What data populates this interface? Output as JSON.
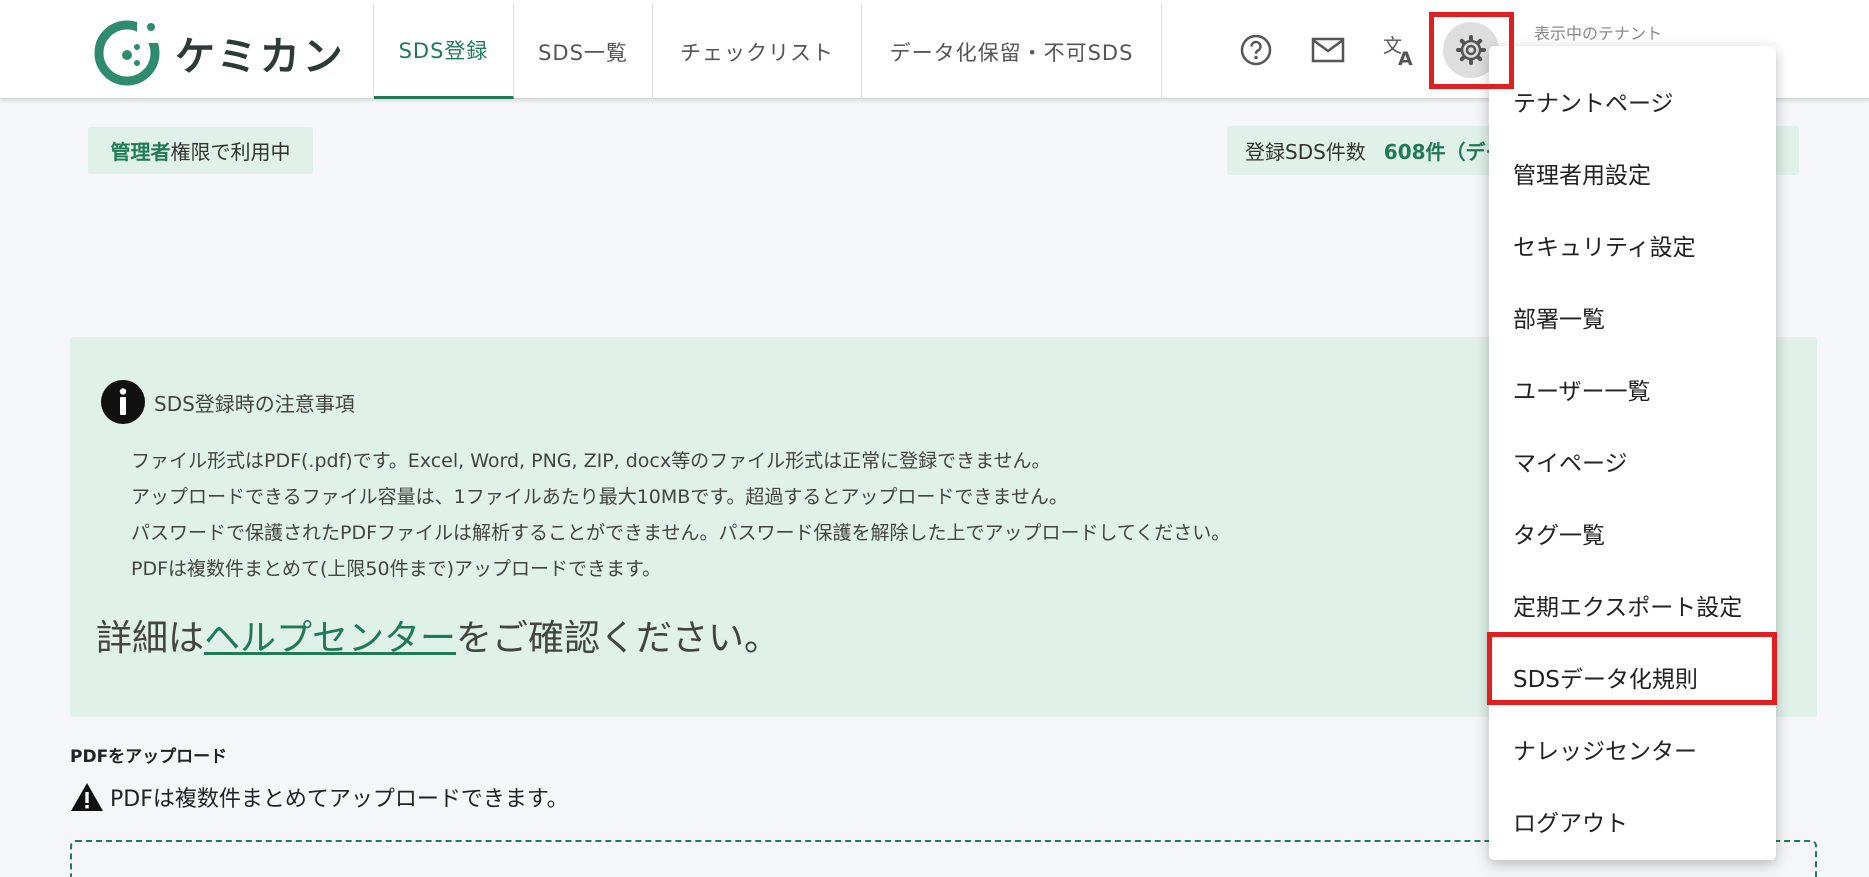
{
  "header": {
    "logo_text": "ケミカン",
    "nav_tabs": [
      {
        "label": "SDS登録",
        "active": true
      },
      {
        "label": "SDS一覧",
        "active": false
      },
      {
        "label": "チェックリスト",
        "active": false
      },
      {
        "label": "データ化保留・不可SDS",
        "active": false
      }
    ],
    "icons": [
      "help-circle-icon",
      "mail-icon",
      "translate-icon",
      "gear-icon"
    ],
    "tenant_label": "表示中のテナント"
  },
  "status": {
    "role_name": "管理者",
    "role_suffix": "権限で利用中",
    "count_label": "登録SDS件数",
    "count_value": "608件（デー"
  },
  "notice": {
    "title": "SDS登録時の注意事項",
    "lines": [
      "ファイル形式はPDF(.pdf)です。Excel, Word, PNG, ZIP, docx等のファイル形式は正常に登録できません。",
      "アップロードできるファイル容量は、1ファイルあたり最大10MBです。超過するとアップロードできません。",
      "パスワードで保護されたPDFファイルは解析することができません。パスワード保護を解除した上でアップロードしてください。",
      "PDFは複数件まとめて(上限50件まで)アップロードできます。"
    ],
    "help_prefix": "詳細は",
    "help_link": "ヘルプセンター",
    "help_suffix": "をご確認ください。"
  },
  "upload": {
    "label": "PDFをアップロード",
    "warning": "PDFは複数件まとめてアップロードできます。"
  },
  "menu": {
    "items": [
      {
        "label": "テナントページ"
      },
      {
        "label": "管理者用設定"
      },
      {
        "label": "セキュリティ設定"
      },
      {
        "label": "部署一覧"
      },
      {
        "label": "ユーザー一覧"
      },
      {
        "label": "マイページ"
      },
      {
        "label": "タグ一覧"
      },
      {
        "label": "定期エクスポート設定"
      },
      {
        "label": "SDSデータ化規則"
      },
      {
        "label": "ナレッジセンター"
      },
      {
        "label": "ログアウト"
      }
    ]
  },
  "colors": {
    "accent": "#1f7a55",
    "badge_bg": "#dff1e8",
    "highlight": "#e02020"
  }
}
